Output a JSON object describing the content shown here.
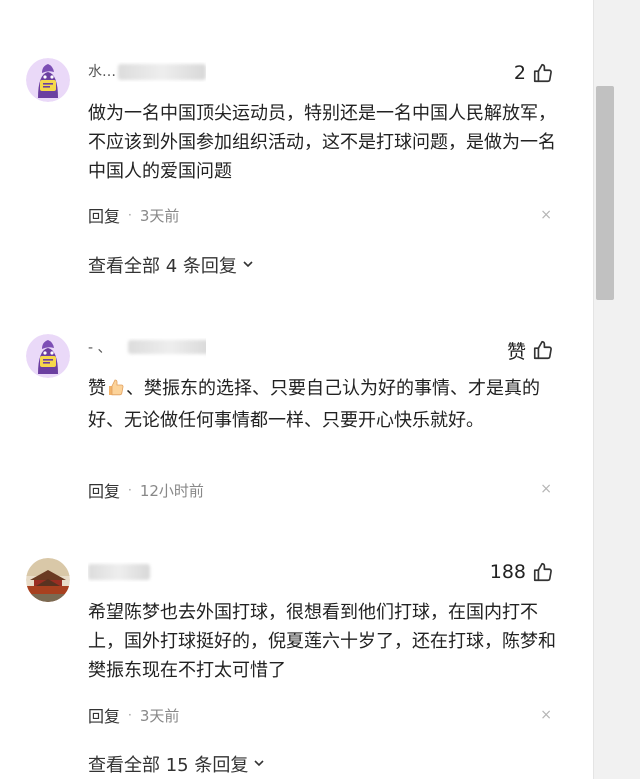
{
  "comments": [
    {
      "username": "水…",
      "likes": "2",
      "text": "做为一名中国顶尖运动员，特别还是一名中国人民解放军，不应该到外国参加组织活动，这不是打球问题，是做为一名中国人的爱国问题",
      "reply_label": "回复",
      "time": "3天前",
      "view_all": "查看全部 4 条回复",
      "avatar": "purple-cartoon-avatar"
    },
    {
      "username": "- 、",
      "likes": "赞",
      "text_prefix": "赞",
      "text": "、樊振东的选择、只要自己认为好的事情、才是真的好、无论做任何事情都一样、只要开心快乐就好。",
      "reply_label": "回复",
      "time": "12小时前",
      "avatar": "purple-cartoon-avatar"
    },
    {
      "username": "",
      "likes": "188",
      "text": "希望陈梦也去外国打球，很想看到他们打球，在国内打不上，国外打球挺好的，倪夏莲六十岁了，还在打球，陈梦和樊振东现在不打太可惜了",
      "reply_label": "回复",
      "time": "3天前",
      "view_all": "查看全部 15 条回复",
      "avatar": "forbidden-city-avatar"
    }
  ],
  "icons": {
    "like": "thumbs-up-icon",
    "chevron": "chevron-down-icon",
    "close": "close-icon"
  },
  "close_glyph": "×",
  "colors": {
    "text": "#222222",
    "muted": "#888888",
    "avatar_bg": "#e9d8f7",
    "avatar_purple": "#6b3fa0"
  }
}
